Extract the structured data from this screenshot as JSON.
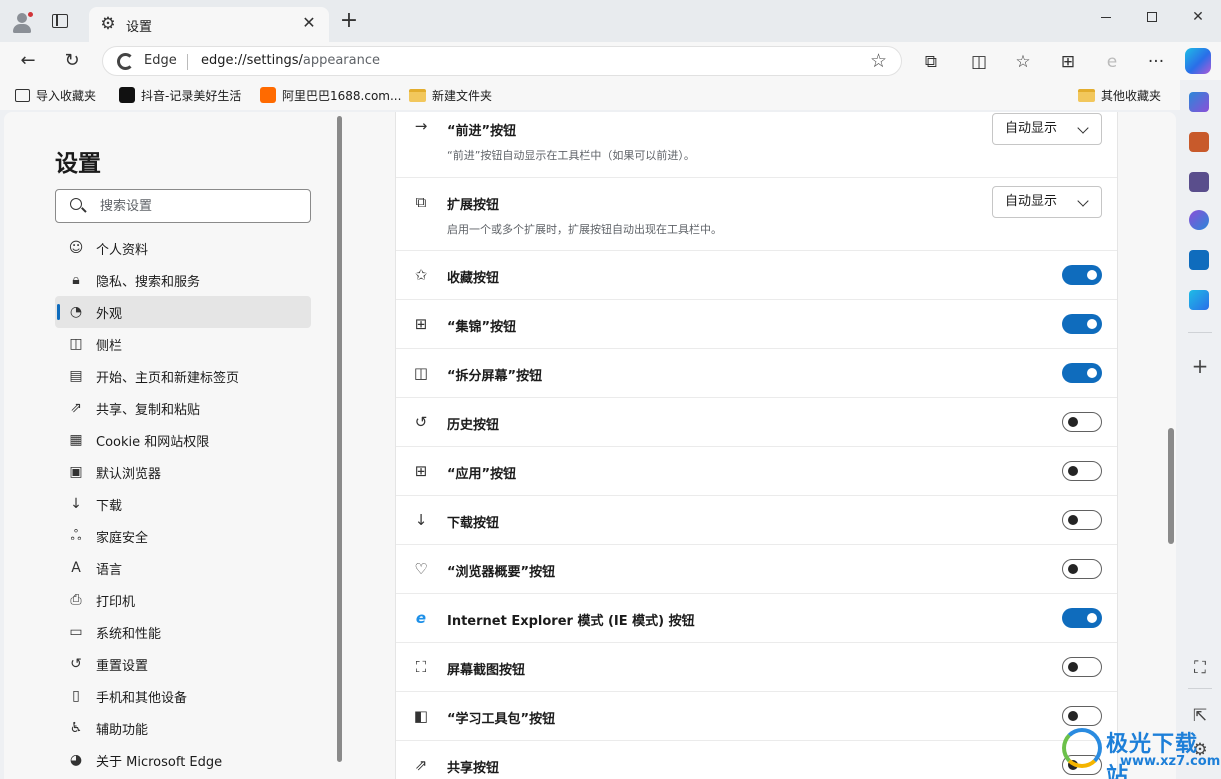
{
  "window": {
    "tab_title": "设置",
    "newtab_glyph": "+",
    "close_glyph": "✕"
  },
  "navbar": {
    "site_label": "Edge",
    "url_host": "edge://settings/",
    "url_path": "appearance"
  },
  "favorites": [
    {
      "label": "导入收藏夹",
      "icon": "import-icon"
    },
    {
      "label": "抖音-记录美好生活",
      "icon": "tiktok-icon"
    },
    {
      "label": "阿里巴巴1688.com...",
      "icon": "alibaba-icon"
    },
    {
      "label": "新建文件夹",
      "icon": "folder-icon"
    },
    {
      "label": "其他收藏夹",
      "icon": "folder-icon"
    }
  ],
  "sidebar": {
    "title": "设置",
    "search_placeholder": "搜索设置",
    "items": [
      {
        "label": "个人资料",
        "icon": "profile-icon"
      },
      {
        "label": "隐私、搜索和服务",
        "icon": "lock-icon"
      },
      {
        "label": "外观",
        "icon": "palette-icon",
        "active": true
      },
      {
        "label": "侧栏",
        "icon": "sidebar-icon"
      },
      {
        "label": "开始、主页和新建标签页",
        "icon": "home-icon"
      },
      {
        "label": "共享、复制和粘贴",
        "icon": "share-icon"
      },
      {
        "label": "Cookie 和网站权限",
        "icon": "cookie-icon"
      },
      {
        "label": "默认浏览器",
        "icon": "browser-icon"
      },
      {
        "label": "下载",
        "icon": "download-icon"
      },
      {
        "label": "家庭安全",
        "icon": "family-icon"
      },
      {
        "label": "语言",
        "icon": "language-icon"
      },
      {
        "label": "打印机",
        "icon": "printer-icon"
      },
      {
        "label": "系统和性能",
        "icon": "laptop-icon"
      },
      {
        "label": "重置设置",
        "icon": "reset-icon"
      },
      {
        "label": "手机和其他设备",
        "icon": "phone-icon"
      },
      {
        "label": "辅助功能",
        "icon": "accessibility-icon"
      },
      {
        "label": "关于 Microsoft Edge",
        "icon": "edge-icon"
      }
    ]
  },
  "settings": {
    "forward": {
      "label": "“前进”按钮",
      "desc": "“前进”按钮自动显示在工具栏中（如果可以前进）。",
      "value": "自动显示"
    },
    "extensions": {
      "label": "扩展按钮",
      "desc": "启用一个或多个扩展时，扩展按钮自动出现在工具栏中。",
      "value": "自动显示"
    },
    "toggles": [
      {
        "label": "收藏按钮",
        "icon": "favorites-icon",
        "on": true
      },
      {
        "label": "“集锦”按钮",
        "icon": "collections-icon",
        "on": true
      },
      {
        "label": "“拆分屏幕”按钮",
        "icon": "split-screen-icon",
        "on": true
      },
      {
        "label": "历史按钮",
        "icon": "history-icon",
        "on": false
      },
      {
        "label": "“应用”按钮",
        "icon": "apps-icon",
        "on": false
      },
      {
        "label": "下载按钮",
        "icon": "download-icon",
        "on": false
      },
      {
        "label": "“浏览器概要”按钮",
        "icon": "heartbeat-icon",
        "on": false
      },
      {
        "label": "Internet Explorer 模式 (IE 模式) 按钮",
        "icon": "ie-icon",
        "on": true
      },
      {
        "label": "屏幕截图按钮",
        "icon": "screenshot-icon",
        "on": false
      },
      {
        "label": "“学习工具包”按钮",
        "icon": "learning-icon",
        "on": false
      },
      {
        "label": "共享按钮",
        "icon": "share-icon",
        "on": false
      }
    ]
  },
  "watermark": {
    "name": "极光下载站",
    "url": "www.xz7.com"
  },
  "colors": {
    "accent": "#0f6cbd",
    "toggle_off_knob": "#242424"
  }
}
